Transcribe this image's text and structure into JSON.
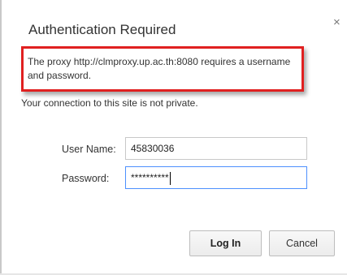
{
  "dialog": {
    "title": "Authentication Required",
    "close_icon": "×",
    "message": "The proxy http://clmproxy.up.ac.th:8080 requires a username and password.",
    "secondary_message": "Your connection to this site is not private."
  },
  "form": {
    "username_label": "User Name:",
    "username_value": "45830036",
    "password_label": "Password:",
    "password_masked": "**********"
  },
  "buttons": {
    "login_label": "Log In",
    "cancel_label": "Cancel"
  },
  "colors": {
    "highlight_border": "#e02020",
    "focus_border": "#4d90fe"
  }
}
